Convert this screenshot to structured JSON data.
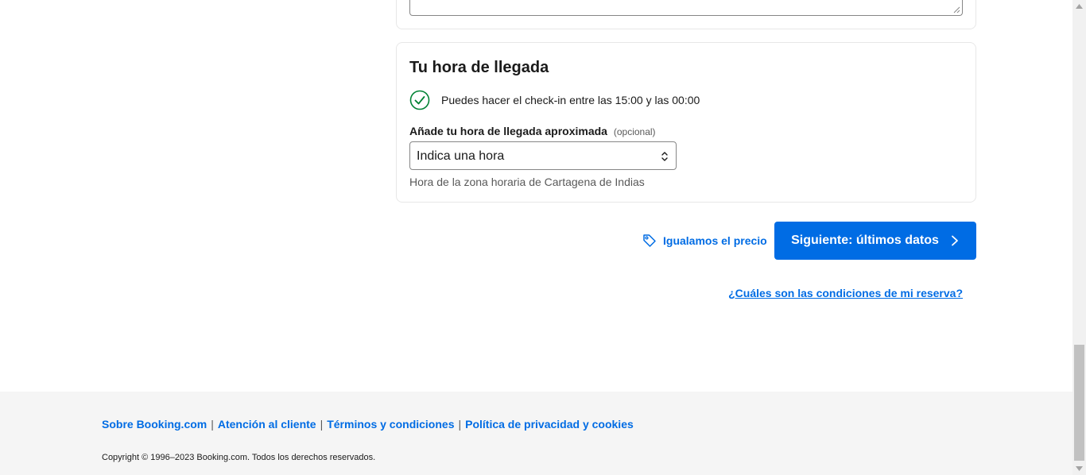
{
  "arrival": {
    "title": "Tu hora de llegada",
    "checkin_info": "Puedes hacer el check-in entre las 15:00 y las 00:00",
    "label": "Añade tu hora de llegada aproximada",
    "optional": "(opcional)",
    "select_value": "Indica una hora",
    "timezone_note": "Hora de la zona horaria de Cartagena de Indias"
  },
  "actions": {
    "price_match": "Igualamos el precio",
    "next": "Siguiente: últimos datos",
    "conditions": "¿Cuáles son las condiciones de mi reserva?"
  },
  "footer": {
    "links": [
      "Sobre Booking.com",
      "Atención al cliente",
      "Términos y condiciones",
      "Política de privacidad y cookies"
    ],
    "copyright": "Copyright © 1996–2023 Booking.com. Todos los derechos reservados."
  },
  "icons": {
    "check": "check-circle-icon",
    "tag": "tag-icon",
    "chevron": "chevron-right-icon",
    "select_arrows": "sort-arrows-icon"
  },
  "colors": {
    "brand_blue": "#006ce4",
    "success_green": "#008234",
    "footer_bg": "#f5f5f5",
    "muted_text": "#595959"
  }
}
